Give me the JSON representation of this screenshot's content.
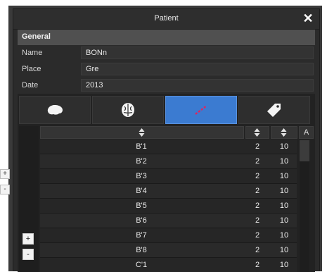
{
  "window": {
    "title": "Patient",
    "close_glyph": "✕"
  },
  "side_handles": [
    "+",
    "-"
  ],
  "general": {
    "header": "General",
    "fields": [
      {
        "label": "Name",
        "value": "BONn"
      },
      {
        "label": "Place",
        "value": "Gre"
      },
      {
        "label": "Date",
        "value": "2013"
      }
    ]
  },
  "tabs": [
    {
      "icon": "brain-icon",
      "active": false
    },
    {
      "icon": "brain-top-icon",
      "active": false
    },
    {
      "icon": "electrode-icon",
      "active": true
    },
    {
      "icon": "tag-icon",
      "active": false
    }
  ],
  "table": {
    "header_last": "A",
    "rows": [
      {
        "name": "B'1",
        "a": "2",
        "b": "10"
      },
      {
        "name": "B'2",
        "a": "2",
        "b": "10"
      },
      {
        "name": "B'3",
        "a": "2",
        "b": "10"
      },
      {
        "name": "B'4",
        "a": "2",
        "b": "10"
      },
      {
        "name": "B'5",
        "a": "2",
        "b": "10"
      },
      {
        "name": "B'6",
        "a": "2",
        "b": "10"
      },
      {
        "name": "B'7",
        "a": "2",
        "b": "10"
      },
      {
        "name": "B'8",
        "a": "2",
        "b": "10"
      },
      {
        "name": "C'1",
        "a": "2",
        "b": "10"
      }
    ]
  },
  "list_buttons": {
    "add": "+",
    "remove": "-"
  },
  "colors": {
    "accent": "#3b7bd1",
    "electrode": "#e0245e"
  }
}
